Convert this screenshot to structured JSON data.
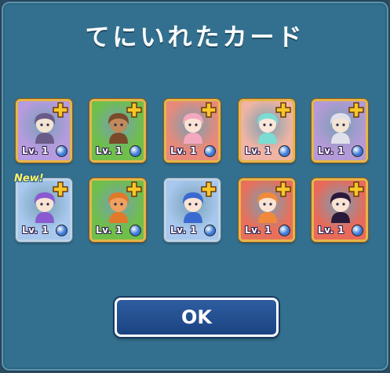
{
  "dialog": {
    "title": "てにいれたカード",
    "ok_label": "OK"
  },
  "cards": [
    {
      "level": "Lv. 1",
      "bg": "#b79be0",
      "hair": "#6b5b88",
      "skin": "#f4e4d4",
      "attr": "#3a7ad8",
      "is_new": false,
      "new_label": ""
    },
    {
      "level": "Lv. 1",
      "bg": "#6fbf4a",
      "hair": "#7a4a2a",
      "skin": "#c08a5a",
      "attr": "#3a7ad8",
      "is_new": false,
      "new_label": ""
    },
    {
      "level": "Lv. 1",
      "bg": "#e88a7a",
      "hair": "#f4a8c0",
      "skin": "#fbe3d4",
      "attr": "#3a7ad8",
      "is_new": false,
      "new_label": ""
    },
    {
      "level": "Lv. 1",
      "bg": "#f0b4a4",
      "hair": "#7adcd2",
      "skin": "#fbe6da",
      "attr": "#3a7ad8",
      "is_new": false,
      "new_label": ""
    },
    {
      "level": "Lv. 1",
      "bg": "#b49ad6",
      "hair": "#e0e0ea",
      "skin": "#f4e4d4",
      "attr": "#3a7ad8",
      "is_new": false,
      "new_label": ""
    },
    {
      "level": "Lv. 1",
      "bg": "#a8c8ee",
      "hair": "#8a5ad0",
      "skin": "#fbe3d4",
      "attr": "#3a7ad8",
      "is_new": true,
      "new_label": "New!"
    },
    {
      "level": "Lv. 1",
      "bg": "#6fbf4a",
      "hair": "#e07a2a",
      "skin": "#f0a060",
      "attr": "#3a7ad8",
      "is_new": false,
      "new_label": ""
    },
    {
      "level": "Lv. 1",
      "bg": "#a8c8ee",
      "hair": "#3a6ad0",
      "skin": "#fbe3d4",
      "attr": "#3a7ad8",
      "is_new": false,
      "new_label": ""
    },
    {
      "level": "Lv. 1",
      "bg": "#e8705a",
      "hair": "#f08a3a",
      "skin": "#fbe3d4",
      "attr": "#3a7ad8",
      "is_new": false,
      "new_label": ""
    },
    {
      "level": "Lv. 1",
      "bg": "#e86a5a",
      "hair": "#2a1a3a",
      "skin": "#fbe3d4",
      "attr": "#3a7ad8",
      "is_new": false,
      "new_label": ""
    }
  ]
}
